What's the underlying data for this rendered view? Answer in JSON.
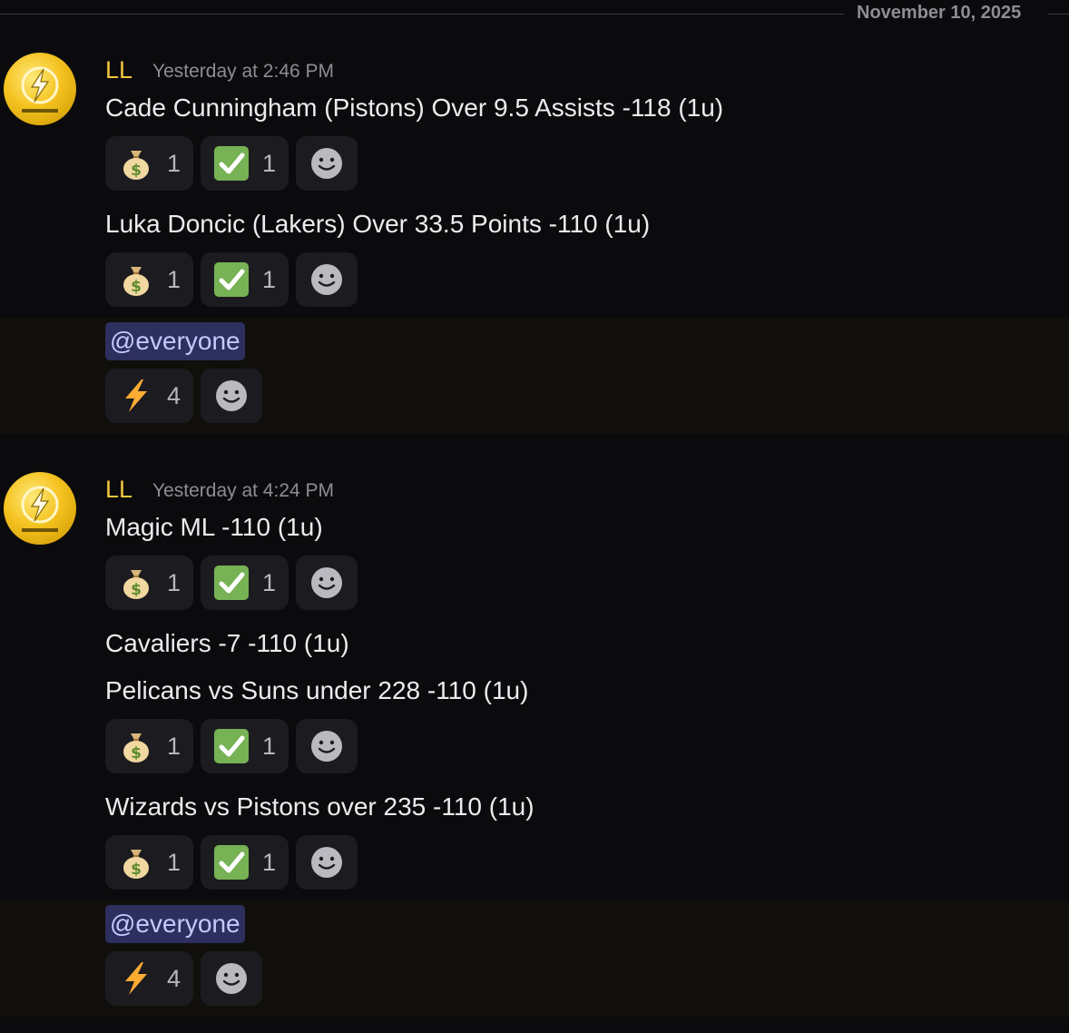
{
  "date_divider": "November 10, 2025",
  "messages": [
    {
      "author": "LL",
      "time": "Yesterday at 2:46 PM",
      "lines": [
        "Cade Cunningham (Pistons) Over 9.5 Assists -118 (1u)",
        "Luka Doncic (Lakers) Over 33.5 Points -110 (1u)"
      ],
      "mention": "@everyone"
    },
    {
      "author": "LL",
      "time": "Yesterday at 4:24 PM",
      "lines": [
        "Magic ML -110 (1u)",
        "Cavaliers -7 -110 (1u)",
        "Pelicans vs Suns under 228 -110 (1u)",
        "Wizards vs Pistons over 235 -110 (1u)"
      ],
      "mention": "@everyone"
    }
  ],
  "reactions": {
    "money_bag_count": "1",
    "check_count": "1",
    "lightning_count": "4"
  },
  "icons": [
    "money-bag-icon",
    "check-mark-icon",
    "lightning-icon",
    "add-reaction-icon",
    "avatar-lightning-logo"
  ],
  "colors": {
    "background": "#0b0b0d",
    "username": "#f3c63f",
    "mention_bg": "#2d2f5e",
    "mention_text": "#c5c9ff",
    "check": "#77b255"
  }
}
